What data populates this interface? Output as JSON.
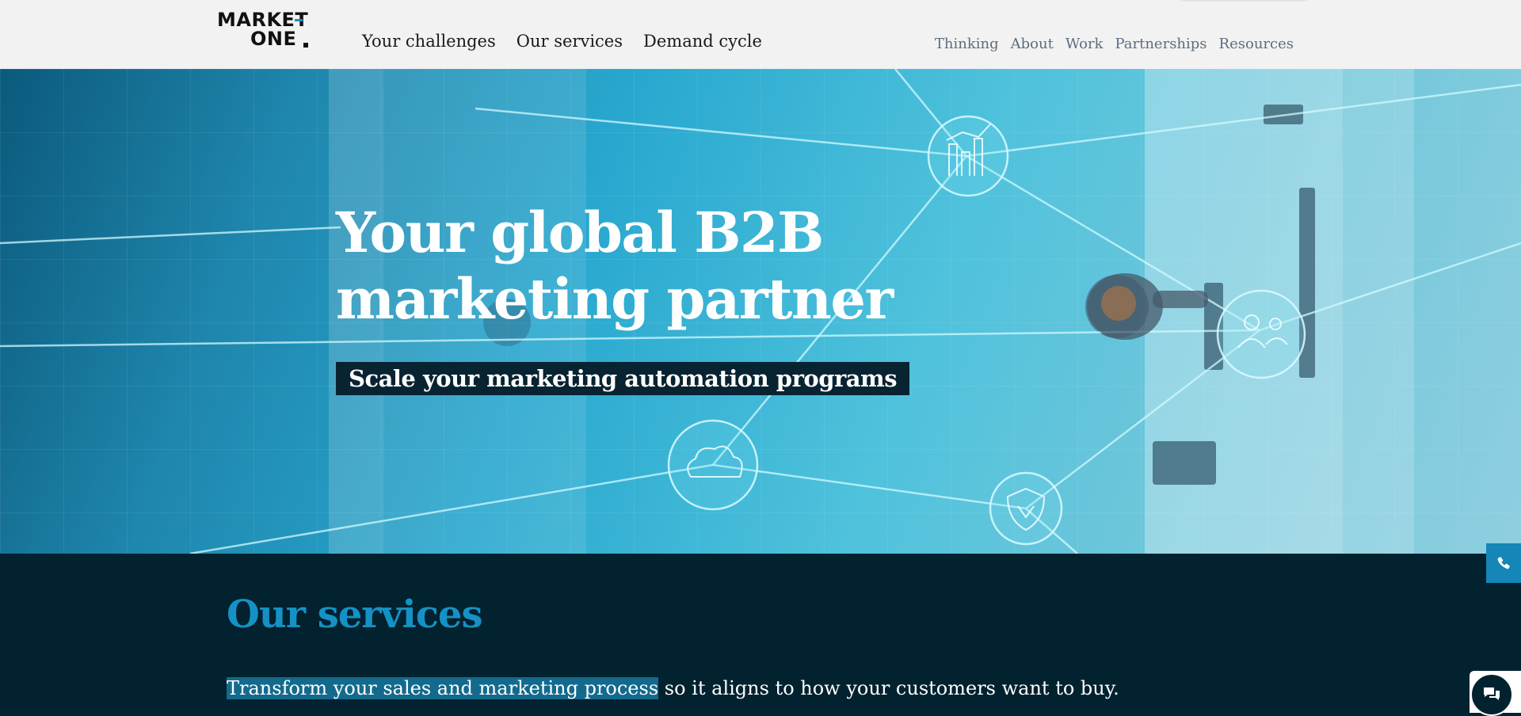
{
  "header": {
    "logo": {
      "line1": "MARKET",
      "line2": "ONE",
      "dot": "."
    },
    "primary_nav": [
      "Your challenges",
      "Our services",
      "Demand cycle"
    ],
    "secondary_nav": [
      "Thinking",
      "About",
      "Work",
      "Partnerships",
      "Resources"
    ]
  },
  "hero": {
    "title": "Your global B2B marketing partner",
    "subtitle": "Scale your marketing automation programs"
  },
  "services": {
    "heading": "Our services",
    "text_highlight": "Transform your sales and marketing process",
    "text_rest": " so it aligns to how your customers want to buy."
  },
  "floating": {
    "phone_icon": "phone-icon",
    "chat_icon": "chat-icon"
  },
  "colors": {
    "accent": "#1592c5",
    "dark_navy": "#02222f",
    "header_bg": "#f2f2f2"
  }
}
